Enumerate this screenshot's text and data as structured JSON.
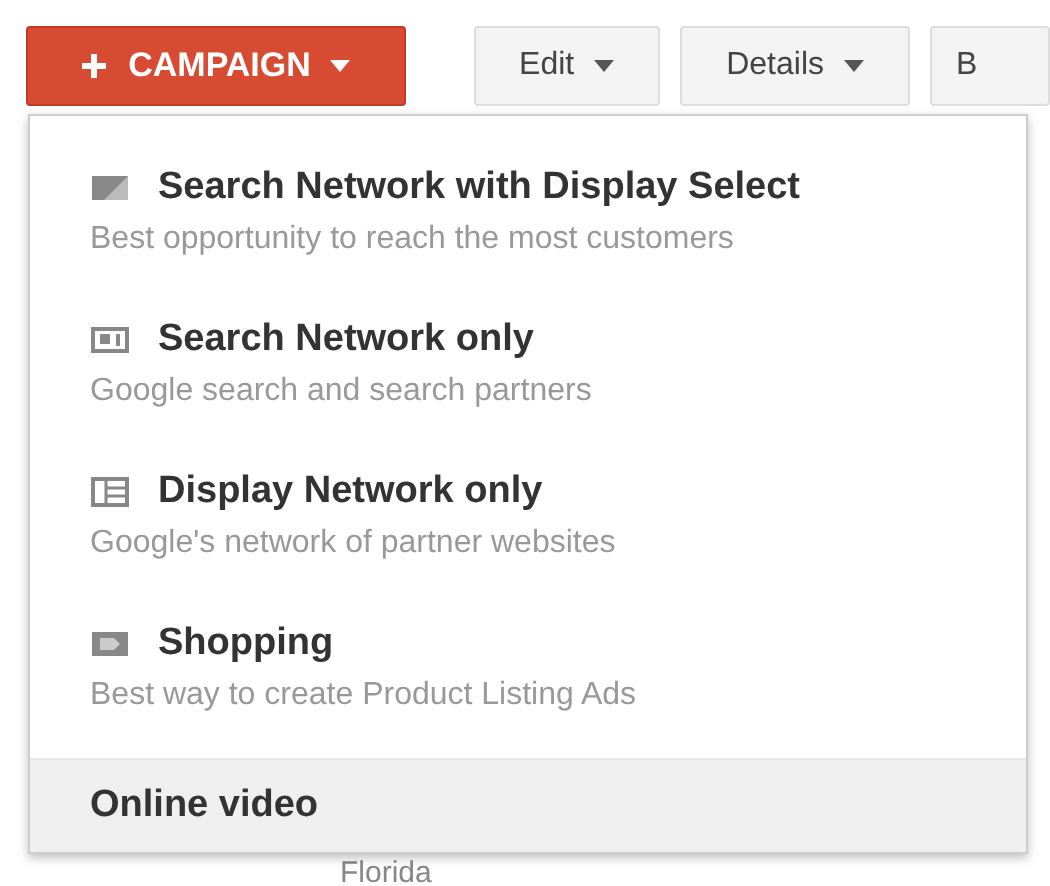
{
  "toolbar": [
    {
      "label": "CAMPAIGN",
      "kind": "primary"
    },
    {
      "label": "Edit",
      "kind": "menu"
    },
    {
      "label": "Details",
      "kind": "menu"
    },
    {
      "label": "B",
      "kind": "cut"
    }
  ],
  "menu": {
    "items": [
      {
        "title": "Search Network with Display Select",
        "subtitle": "Best opportunity to reach the most customers",
        "kind": "option",
        "selected": false
      },
      {
        "title": "Search Network only",
        "subtitle": "Google search and search partners",
        "kind": "option",
        "selected": false
      },
      {
        "title": "Display Network only",
        "subtitle": "Google's network of partner websites",
        "kind": "option",
        "selected": false
      },
      {
        "title": "Shopping",
        "subtitle": "Best way to create Product Listing Ads",
        "kind": "option",
        "selected": false
      },
      {
        "title": "Online video",
        "kind": "plain",
        "selected": true
      }
    ]
  },
  "table_peek": {
    "cell": "Florida"
  }
}
